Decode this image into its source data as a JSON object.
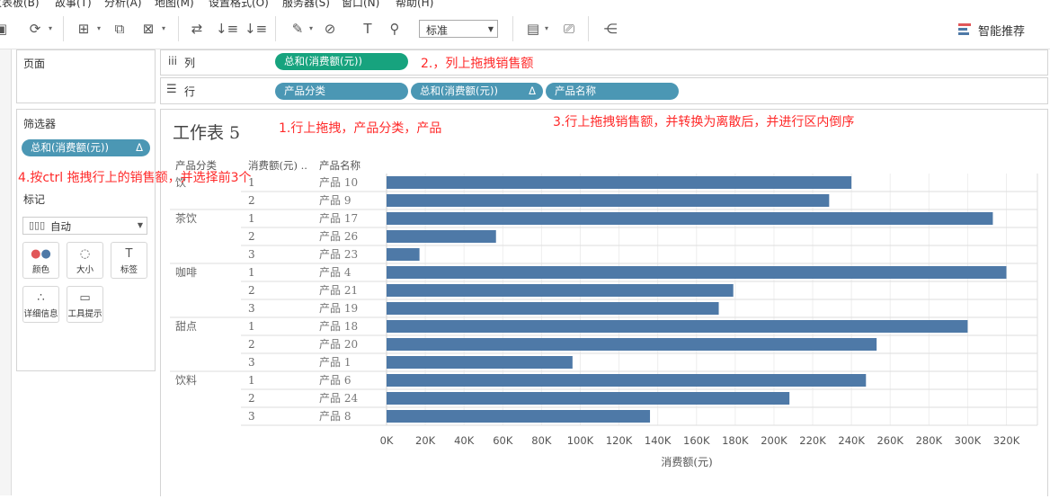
{
  "menu": [
    "仪表板(B)",
    "故事(T)",
    "分析(A)",
    "地图(M)",
    "设置格式(O)",
    "服务器(S)",
    "窗口(N)",
    "帮助(H)"
  ],
  "toolbar": {
    "fit_value": "标准",
    "show_me_label": "智能推荐"
  },
  "pages_panel": {
    "title": "页面"
  },
  "filters_panel": {
    "title": "筛选器",
    "pill": "总和(消费额(元))",
    "pill_icon": "Δ"
  },
  "marks_panel": {
    "title": "标记",
    "mark_type": "自动",
    "buttons": [
      {
        "label": "颜色",
        "icon": "color-icon"
      },
      {
        "label": "大小",
        "icon": "size-icon"
      },
      {
        "label": "标签",
        "icon": "label-icon"
      },
      {
        "label": "详细信息",
        "icon": "detail-icon"
      },
      {
        "label": "工具提示",
        "icon": "tooltip-icon"
      }
    ]
  },
  "columns_shelf": {
    "label": "列",
    "icon": "iii",
    "pills": [
      {
        "text": "总和(消费额(元))"
      }
    ]
  },
  "rows_shelf": {
    "label": "行",
    "icon": "☰",
    "pills": [
      {
        "text": "产品分类"
      },
      {
        "text": "总和(消费额(元))",
        "icon": "Δ"
      },
      {
        "text": "产品名称"
      }
    ]
  },
  "annotations": {
    "a1": "1.行上拖拽，产品分类，产品",
    "a2": "2.，列上拖拽销售额",
    "a3": "3.行上拖拽销售额，并转换为离散后，并进行区内倒序",
    "a4": "4.按ctrl 拖拽行上的销售额，并选择前3个"
  },
  "colors": {
    "bar": "#4e79a7",
    "pill_green": "#17a37e",
    "pill_blue": "#4b97b4",
    "annotation": "#ff2a2a"
  },
  "chart_data": {
    "type": "bar",
    "title": "工作表 5",
    "header_labels": [
      "产品分类",
      "消费额(元) ..",
      "产品名称"
    ],
    "rows": [
      {
        "category": "饮",
        "rank": "1",
        "product": "产品 10",
        "value": 240000
      },
      {
        "category": "",
        "rank": "2",
        "product": "产品 9",
        "value": 228500
      },
      {
        "category": "茶饮",
        "rank": "1",
        "product": "产品 17",
        "value": 313000
      },
      {
        "category": "",
        "rank": "2",
        "product": "产品 26",
        "value": 56500
      },
      {
        "category": "",
        "rank": "3",
        "product": "产品 23",
        "value": 17000
      },
      {
        "category": "咖啡",
        "rank": "1",
        "product": "产品 4",
        "value": 320000
      },
      {
        "category": "",
        "rank": "2",
        "product": "产品 21",
        "value": 179000
      },
      {
        "category": "",
        "rank": "3",
        "product": "产品 19",
        "value": 171500
      },
      {
        "category": "甜点",
        "rank": "1",
        "product": "产品 18",
        "value": 300000
      },
      {
        "category": "",
        "rank": "2",
        "product": "产品 20",
        "value": 253000
      },
      {
        "category": "",
        "rank": "3",
        "product": "产品 1",
        "value": 96000
      },
      {
        "category": "饮料",
        "rank": "1",
        "product": "产品 6",
        "value": 247500
      },
      {
        "category": "",
        "rank": "2",
        "product": "产品 24",
        "value": 208000
      },
      {
        "category": "",
        "rank": "3",
        "product": "产品 8",
        "value": 136000
      }
    ],
    "x_ticks": [
      "0K",
      "20K",
      "40K",
      "60K",
      "80K",
      "100K",
      "120K",
      "140K",
      "160K",
      "180K",
      "200K",
      "220K",
      "240K",
      "260K",
      "280K",
      "300K",
      "320K"
    ],
    "xlabel": "消费额(元)",
    "xlim": [
      0,
      320000
    ],
    "grid": true
  }
}
